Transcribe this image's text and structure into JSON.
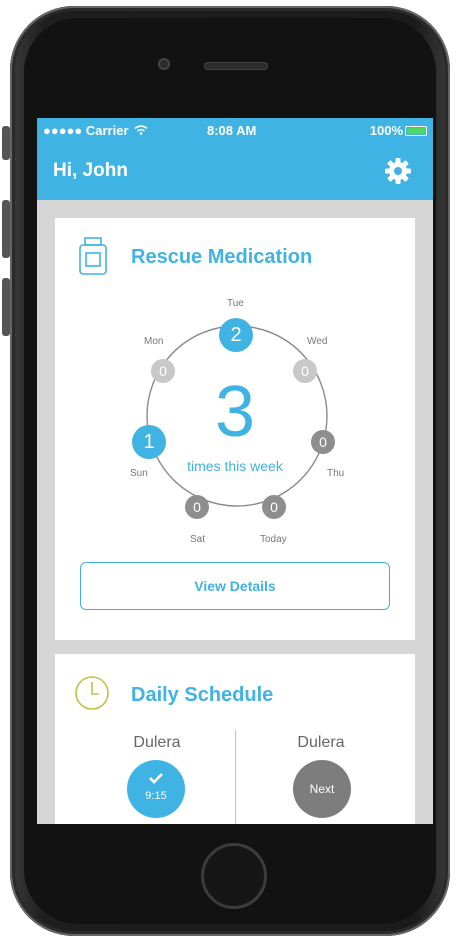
{
  "status_bar": {
    "carrier": "●●●●● Carrier",
    "time": "8:08 AM",
    "battery_percent": "100%",
    "battery_level": 1.0
  },
  "header": {
    "greeting": "Hi, John",
    "settings_icon": "gear-icon"
  },
  "rescue": {
    "title": "Rescue Medication",
    "icon": "medicine-bottle-icon",
    "total": "3",
    "caption": "times this week",
    "days": [
      {
        "label": "Tue",
        "count": "2"
      },
      {
        "label": "Wed",
        "count": "0"
      },
      {
        "label": "Thu",
        "count": "0"
      },
      {
        "label": "Today",
        "count": "0"
      },
      {
        "label": "Sat",
        "count": "0"
      },
      {
        "label": "Sun",
        "count": "1"
      },
      {
        "label": "Mon",
        "count": "0"
      }
    ],
    "button_label": "View Details"
  },
  "schedule": {
    "title": "Daily Schedule",
    "icon": "clock-icon",
    "items": [
      {
        "name": "Dulera",
        "time": "9:15",
        "status_icon": "checkmark-icon"
      },
      {
        "name": "Dulera",
        "status": "Next"
      }
    ]
  },
  "colors": {
    "accent": "#3fb3e3",
    "light_dot": "#c8c8c8",
    "dark_dot": "#8e8e8e",
    "clock": "#b5c84a"
  }
}
